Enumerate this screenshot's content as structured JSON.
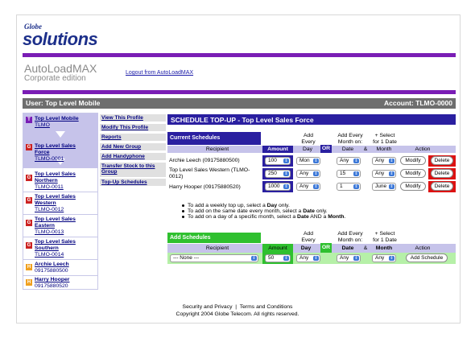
{
  "brand": {
    "globe": "Globe",
    "solutions": "solutions"
  },
  "app": {
    "title": "AutoLoadMAX",
    "subtitle": "Corporate edition",
    "logout": "Logout from AutoLoadMAX"
  },
  "userbar": {
    "user": "User: Top Level Mobile",
    "account": "Account: TLMO-0000"
  },
  "tree": [
    {
      "badge": "T",
      "color": "#7a1db5",
      "name": "Top Level Mobile",
      "id": "TLMO"
    },
    {
      "badge": "G",
      "color": "#cc2222",
      "name": "Top Level Sales Force",
      "id": "TLMO-0001"
    },
    {
      "badge": "G",
      "color": "#cc2222",
      "name": "Top Level Sales Northern",
      "id": "TLMO-0011"
    },
    {
      "badge": "G",
      "color": "#cc2222",
      "name": "Top Level Sales Western",
      "id": "TLMO-0012"
    },
    {
      "badge": "G",
      "color": "#cc2222",
      "name": "Top Level Sales Eastern",
      "id": "TLMO-0013"
    },
    {
      "badge": "G",
      "color": "#cc2222",
      "name": "Top Level Sales Southern",
      "id": "TLMO-0014"
    },
    {
      "badge": "H",
      "color": "#f0a020",
      "name": "Archie Leech",
      "id": "09175880500"
    },
    {
      "badge": "H",
      "color": "#f0a020",
      "name": "Harry Hooper",
      "id": "09175880520"
    }
  ],
  "menu": [
    "View This Profile",
    "Modify This Profile",
    "Reports",
    "Add New Group",
    "Add Handyphone",
    "Transfer Stock to this Group",
    "Top-Up Schedules"
  ],
  "main": {
    "title": "SCHEDULE TOP-UP - Top Level Sales Force",
    "current_label": "Current Schedules",
    "add_label": "Add Schedules"
  },
  "headers": {
    "add_every": "Add Every",
    "add_every_month_on": "Add Every Month on:",
    "select_for_1_date": "+ Select for 1 Date",
    "recipient": "Recipient",
    "amount": "Amount",
    "day": "Day",
    "or": "OR",
    "date": "Date",
    "amp": "&",
    "month": "Month",
    "action": "Action"
  },
  "schedules": [
    {
      "recipient": "Archie Leech (09175880500)",
      "amount": "100",
      "day": "Mon",
      "date": "Any",
      "month": "Any",
      "modify": "Modify",
      "delete": "Delete"
    },
    {
      "recipient": "Top Level Sales Western (TLMO-0012)",
      "amount": "250",
      "day": "Any",
      "date": "15",
      "month": "Any",
      "modify": "Modify",
      "delete": "Delete"
    },
    {
      "recipient": "Harry Hooper (09175880520)",
      "amount": "1000",
      "day": "Any",
      "date": "1",
      "month": "June",
      "modify": "Modify",
      "delete": "Delete"
    }
  ],
  "notes": [
    "To add a weekly top up, select a Day only.",
    "To add on the same date every month, select a Date only.",
    "To add on a day of a specific month, select a Date AND a Month."
  ],
  "add_row": {
    "recipient": "--- None ---",
    "amount": "50",
    "day": "Any",
    "date": "Any",
    "month": "Any",
    "button": "Add Schedule"
  },
  "footer": {
    "links": "Security and Privacy  |  Terms and Conditions",
    "copyright": "Copyright 2004 Globe Telecom. All rights reserved."
  }
}
